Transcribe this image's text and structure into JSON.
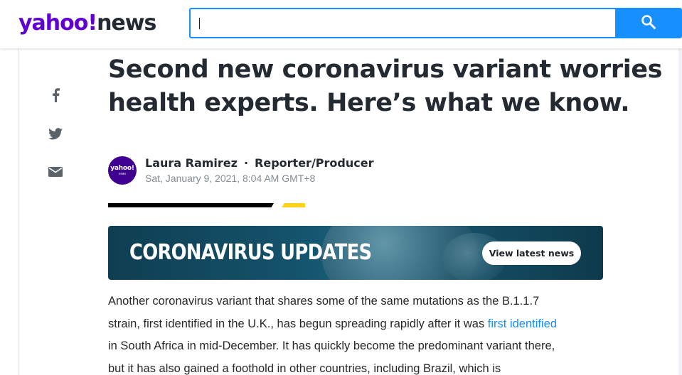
{
  "header": {
    "logo_brand": "yahoo!",
    "logo_section": "news",
    "search": {
      "value": "",
      "placeholder": ""
    }
  },
  "share": {
    "icons": [
      "facebook-icon",
      "twitter-icon",
      "mail-icon"
    ]
  },
  "article": {
    "headline": "Second new coronavirus variant worries health experts. Here’s what we know.",
    "author": "Laura Ramirez",
    "separator": "·",
    "role": "Reporter/Producer",
    "date": "Sat, January 9, 2021, 8:04 AM GMT+8",
    "avatar_text": "yahoo!",
    "avatar_subtext": "news"
  },
  "banner": {
    "title": "CORONAVIRUS UPDATES",
    "button": "View latest news"
  },
  "body": {
    "line1": "Another coronavirus variant that shares some of the same mutations as the B.1.1.7",
    "line2_pre": "strain, first identified in the U.K., has begun spreading rapidly after it was ",
    "line2_link": "first identified",
    "line3": "in South Africa in mid-December. It has quickly become the predominant variant there,",
    "line4": "but it has also gained a foothold in other countries, including Brazil, which is"
  },
  "colors": {
    "brand_purple": "#6001d2",
    "accent_blue": "#188fff",
    "accent_yellow": "#ffd319"
  }
}
